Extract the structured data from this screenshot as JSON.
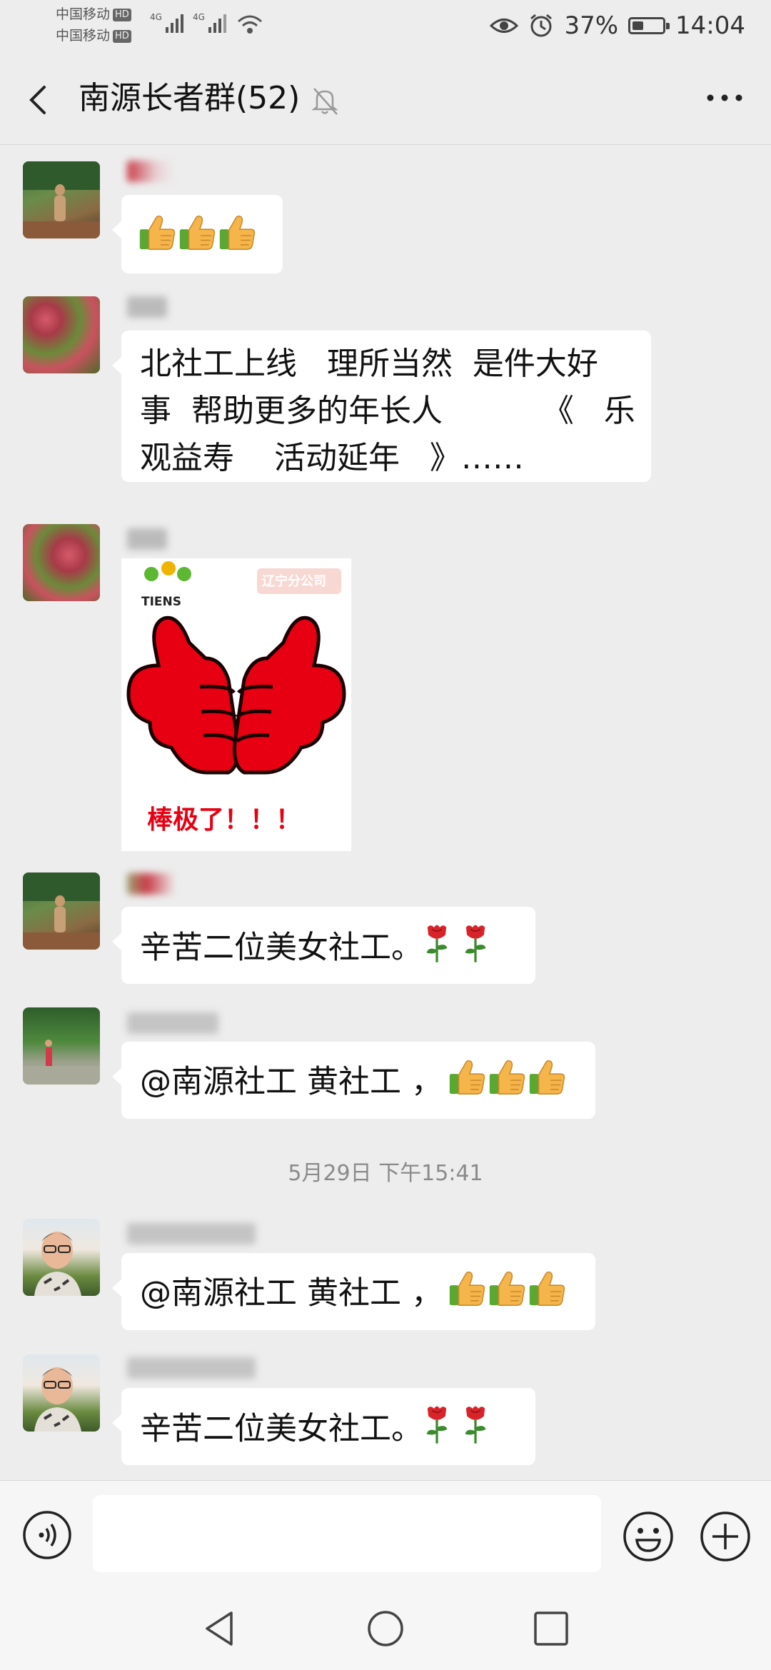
{
  "status_bar": {
    "carrier_1": "中国移动",
    "carrier_2": "中国移动",
    "hd_1": "HD",
    "hd_2": "HD",
    "network_1": "4G",
    "network_2": "4G",
    "battery_percent": "37%",
    "battery_level": 0.37,
    "time": "14:04"
  },
  "header": {
    "title": "南源长者群(52)",
    "icons": [
      "back-arrow-icon",
      "muted-bell-icon",
      "more-dots-icon"
    ]
  },
  "messages": [
    {
      "type": "emoji",
      "emoji": [
        "thumbs-up",
        "thumbs-up",
        "thumbs-up"
      ]
    },
    {
      "type": "text",
      "lines": [
        "北社工上线   理所当然  是件大好",
        "事  帮助更多的年长人          《   乐",
        "观益寿    活动延年   》……"
      ]
    },
    {
      "type": "image",
      "sticker": {
        "brand": "TIENS",
        "badge": "辽宁分公司",
        "caption": "棒极了！！！"
      }
    },
    {
      "type": "text",
      "text": "辛苦二位美女社工。",
      "emoji": [
        "rose",
        "rose"
      ]
    },
    {
      "type": "text",
      "text": "@南源社工 黄社工 ，",
      "emoji": [
        "thumbs-up",
        "thumbs-up",
        "thumbs-up"
      ]
    },
    {
      "type": "text",
      "text": "@南源社工 黄社工 ，",
      "emoji": [
        "thumbs-up",
        "thumbs-up",
        "thumbs-up"
      ]
    },
    {
      "type": "text",
      "text": "辛苦二位美女社工。",
      "emoji": [
        "rose",
        "rose"
      ]
    }
  ],
  "timestamp": "5月29日 下午15:41",
  "input_bar": {
    "value": "",
    "icons": [
      "voice-icon",
      "emoji-icon",
      "plus-icon"
    ]
  },
  "nav_bar": {
    "icons": [
      "nav-back-icon",
      "nav-home-icon",
      "nav-recents-icon"
    ]
  },
  "colors": {
    "background": "#ededed",
    "bubble": "#ffffff",
    "timestamp": "#8a8a8a",
    "sticker_red": "#e60012"
  }
}
